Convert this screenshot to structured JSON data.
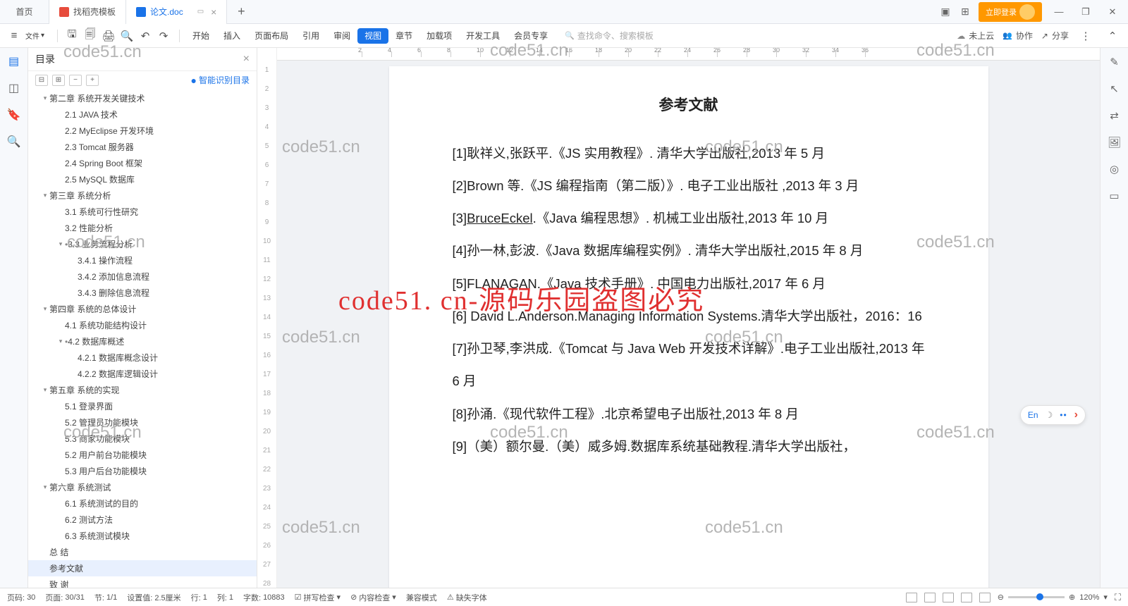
{
  "tabs": {
    "home": "首页",
    "template": "找稻壳模板",
    "doc": "论文.doc"
  },
  "login": "立即登录",
  "toolbar": {
    "file": "文件",
    "menus": [
      "开始",
      "插入",
      "页面布局",
      "引用",
      "审阅",
      "视图",
      "章节",
      "加载项",
      "开发工具",
      "会员专享"
    ],
    "active_index": 5,
    "search_ph": "查找命令、搜索模板",
    "cloud": "未上云",
    "collab": "协作",
    "share": "分享"
  },
  "outline": {
    "title": "目录",
    "smart": "智能识别目录",
    "items": [
      {
        "l": 1,
        "t": "第二章 系统开发关键技术",
        "tg": true
      },
      {
        "l": 2,
        "t": "2.1 JAVA 技术"
      },
      {
        "l": 2,
        "t": "2.2 MyEclipse 开发环境"
      },
      {
        "l": 2,
        "t": "2.3 Tomcat 服务器"
      },
      {
        "l": 2,
        "t": "2.4 Spring   Boot 框架"
      },
      {
        "l": 2,
        "t": "2.5 MySQL 数据库"
      },
      {
        "l": 1,
        "t": "第三章 系统分析",
        "tg": true
      },
      {
        "l": 2,
        "t": "3.1 系统可行性研究"
      },
      {
        "l": 2,
        "t": "3.2 性能分析"
      },
      {
        "l": 2,
        "t": "3.3 业务流程分析",
        "tg": true,
        "dot": true
      },
      {
        "l": 3,
        "t": "3.4.1 操作流程"
      },
      {
        "l": 3,
        "t": "3.4.2 添加信息流程"
      },
      {
        "l": 3,
        "t": "3.4.3 删除信息流程"
      },
      {
        "l": 1,
        "t": "第四章 系统的总体设计",
        "tg": true
      },
      {
        "l": 2,
        "t": "4.1 系统功能结构设计"
      },
      {
        "l": 2,
        "t": "4.2 数据库概述",
        "tg": true,
        "dot": true
      },
      {
        "l": 3,
        "t": "4.2.1 数据库概念设计"
      },
      {
        "l": 3,
        "t": "4.2.2 数据库逻辑设计"
      },
      {
        "l": 1,
        "t": "第五章 系统的实现",
        "tg": true
      },
      {
        "l": 2,
        "t": "5.1 登录界面"
      },
      {
        "l": 2,
        "t": "5.2 管理员功能模块"
      },
      {
        "l": 2,
        "t": "5.3 商家功能模块"
      },
      {
        "l": 2,
        "t": "5.2 用户前台功能模块"
      },
      {
        "l": 2,
        "t": "5.3 用户后台功能模块"
      },
      {
        "l": 1,
        "t": "第六章 系统测试",
        "tg": true
      },
      {
        "l": 2,
        "t": "6.1 系统测试的目的"
      },
      {
        "l": 2,
        "t": "6.2 测试方法"
      },
      {
        "l": 2,
        "t": "6.3 系统测试模块"
      },
      {
        "l": 1,
        "t": "总 结"
      },
      {
        "l": 1,
        "t": "参考文献",
        "sel": true
      },
      {
        "l": 1,
        "t": "致 谢"
      }
    ]
  },
  "gutter_start": 1,
  "gutter_end": 28,
  "doc": {
    "heading": "参考文献",
    "refs": [
      "[1]耿祥义,张跃平.《JS 实用教程》. 清华大学出版社,2013 年 5 月",
      "[2]Brown 等.《JS 编程指南（第二版）》. 电子工业出版社 ,2013 年 3 月",
      "[3]BruceEckel.《Java 编程思想》. 机械工业出版社,2013 年 10 月",
      "[4]孙一林,彭波.《Java 数据库编程实例》. 清华大学出版社,2015 年 8 月",
      "[5]FLANAGAN.《Java 技术手册》. 中国电力出版社,2017 年 6 月",
      "[6] David L.Anderson.Managing   Information Systems.清华大学出版社，2016：16",
      "[7]孙卫琴,李洪成.《Tomcat 与 Java Web 开发技术详解》.电子工业出版社,2013 年 6 月",
      "[8]孙涌.《现代软件工程》.北京希望电子出版社,2013 年 8 月",
      "[9]（美）额尔曼.（美）威多姆.数据库系统基础教程.清华大学出版社，"
    ]
  },
  "float": {
    "en": "En"
  },
  "status": {
    "page_label": "页码:",
    "page": "30",
    "pages_label": "页面:",
    "pages": "30/31",
    "sec_label": "节:",
    "sec": "1/1",
    "set_label": "设置值:",
    "set": "2.5厘米",
    "row_label": "行:",
    "row": "1",
    "col_label": "列:",
    "col": "1",
    "words_label": "字数:",
    "words": "10883",
    "spell": "拼写检查",
    "content": "内容检查",
    "compat": "兼容模式",
    "missing": "缺失字体",
    "zoom": "120%"
  },
  "watermark": "code51.cn",
  "watermark_big": "code51. cn-源码乐园盗图必究"
}
